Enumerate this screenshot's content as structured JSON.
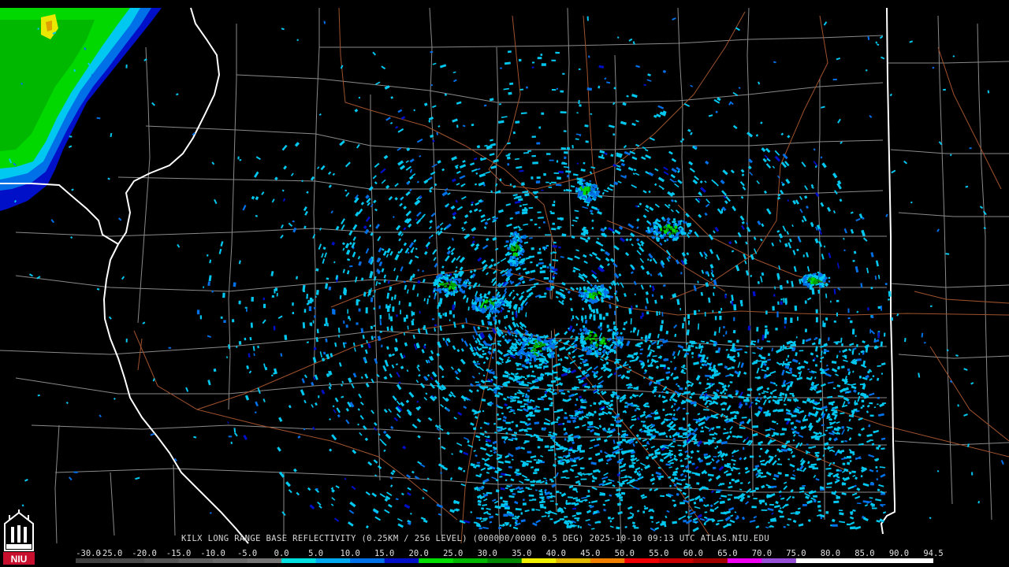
{
  "caption": "KILX LONG RANGE BASE REFLECTIVITY (0.25KM / 256 LEVEL) (000000/0000 0.5 DEG) 2025-10-10 09:13 UTC  ATLAS.NIU.EDU",
  "scale": {
    "labels": [
      "-30.0",
      "-25.0",
      "-20.0",
      "-15.0",
      "-10.0",
      "-5.0",
      "0.0",
      "5.0",
      "10.0",
      "15.0",
      "20.0",
      "25.0",
      "30.0",
      "35.0",
      "40.0",
      "45.0",
      "50.0",
      "55.0",
      "60.0",
      "65.0",
      "70.0",
      "75.0",
      "80.0",
      "85.0",
      "90.0",
      "94.5"
    ],
    "colors": [
      "#404040",
      "#4a4a4a",
      "#555555",
      "#606060",
      "#6a6a6a",
      "#757575",
      "#00e0e0",
      "#00a8f0",
      "#0070e8",
      "#0010c8",
      "#00e000",
      "#00b800",
      "#008800",
      "#f0f000",
      "#e0b800",
      "#f08000",
      "#f00000",
      "#c80000",
      "#a00000",
      "#f000f0",
      "#9850d8",
      "#ffffff",
      "#ffffff",
      "#ffffff",
      "#ffffff"
    ]
  },
  "logo": {
    "text": "NIU",
    "colors": {
      "red": "#c8102e",
      "white": "#ffffff"
    }
  },
  "radar_colors": {
    "light_blue": "#00c8f0",
    "blue": "#0070e8",
    "dark_blue": "#0010c8",
    "green": "#00d800",
    "dark_green": "#00a000",
    "yellow": "#e8e800"
  },
  "map_colors": {
    "background": "#000000",
    "state_border": "#ffffff",
    "county_line": "#8a8a8a",
    "road": "#a0522d"
  }
}
